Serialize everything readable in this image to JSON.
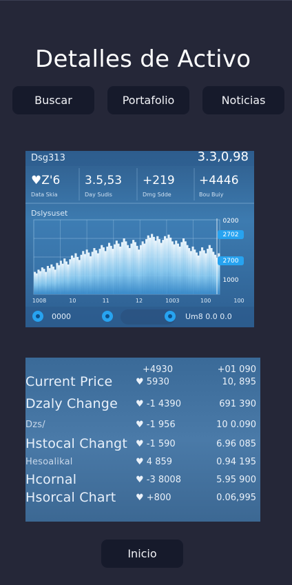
{
  "header": {
    "title": "Detalles de Activo"
  },
  "nav": {
    "buscar": "Buscar",
    "portafolio": "Portafolio",
    "noticias": "Noticias"
  },
  "chart_card": {
    "top_left": "Dsg313",
    "top_right": "3.3,0,98",
    "stats": [
      {
        "value": "♥Z'6",
        "label": "Data Skia"
      },
      {
        "value": "3.5,53",
        "label": "Day Sudis"
      },
      {
        "value": "+219",
        "label": "Dmg Sdde"
      },
      {
        "value": "+4446",
        "label": "Bou Buiy"
      }
    ],
    "section_label": "Dslysuset",
    "right_labels": [
      "0200",
      "2702",
      "2700",
      "1000"
    ],
    "x_labels": [
      "1008",
      "10",
      "11",
      "12",
      "1003",
      "100",
      "100"
    ],
    "footer_left": "0000",
    "footer_right": "Um8 0.0 0.0",
    "accent": "#27a3f0",
    "volume": [
      0.3,
      0.28,
      0.33,
      0.31,
      0.36,
      0.34,
      0.3,
      0.38,
      0.35,
      0.4,
      0.37,
      0.33,
      0.42,
      0.39,
      0.45,
      0.41,
      0.48,
      0.44,
      0.4,
      0.47,
      0.52,
      0.49,
      0.55,
      0.5,
      0.46,
      0.53,
      0.58,
      0.54,
      0.6,
      0.56,
      0.51,
      0.57,
      0.62,
      0.59,
      0.55,
      0.61,
      0.66,
      0.63,
      0.58,
      0.64,
      0.69,
      0.65,
      0.61,
      0.67,
      0.72,
      0.68,
      0.64,
      0.7,
      0.75,
      0.71,
      0.66,
      0.62,
      0.68,
      0.73,
      0.7,
      0.65,
      0.6,
      0.66,
      0.71,
      0.68,
      0.74,
      0.79,
      0.76,
      0.81,
      0.77,
      0.72,
      0.78,
      0.74,
      0.69,
      0.73,
      0.78,
      0.75,
      0.8,
      0.76,
      0.71,
      0.67,
      0.72,
      0.68,
      0.64,
      0.7,
      0.75,
      0.71,
      0.66,
      0.62,
      0.58,
      0.64,
      0.6,
      0.56,
      0.52,
      0.58,
      0.63,
      0.59,
      0.55,
      0.61,
      0.66,
      0.62,
      0.57,
      0.53,
      0.49,
      0.55
    ]
  },
  "table": {
    "header": {
      "v1": "+4930",
      "v2": "+01 090"
    },
    "rows": [
      {
        "label": "Current Price",
        "size": "big",
        "v1": "♥ 5930",
        "v2": "10, 895"
      },
      {
        "label": "Dzaly Change",
        "size": "big",
        "v1": "♥ -1 4390",
        "v2": "691 390"
      },
      {
        "label": "Dzs/",
        "size": "small",
        "v1": "♥ -1 956",
        "v2": "10 0.090"
      },
      {
        "label": "Hstocal Changt",
        "size": "big",
        "v1": "♥ -1 590",
        "v2": "6.96 085"
      },
      {
        "label": "Hesoalikal",
        "size": "small",
        "v1": "♥ 4 859",
        "v2": "0.94 195"
      },
      {
        "label": "Hcornal",
        "size": "big",
        "v1": "♥ -3 8008",
        "v2": "5.95 900"
      },
      {
        "label": "Hsorcal Chart",
        "size": "big",
        "v1": "♥ +800",
        "v2": "0.06,995"
      }
    ]
  },
  "footer": {
    "inicio": "Inicio"
  }
}
